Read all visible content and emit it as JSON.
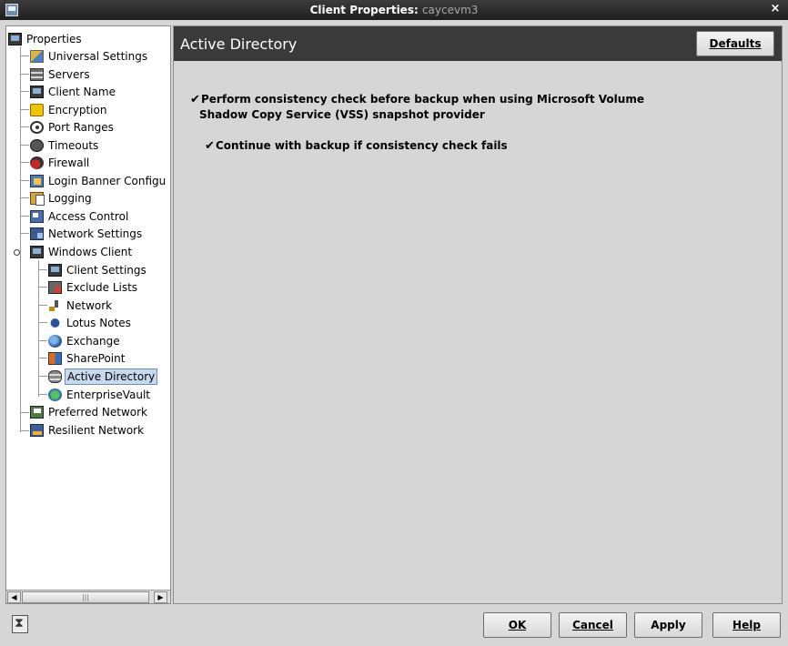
{
  "window": {
    "title_prefix": "Client Properties: ",
    "title_host": "caycevm3",
    "close_glyph": "×"
  },
  "tree": {
    "items": [
      {
        "label": "Properties",
        "icon": "computer-icon"
      },
      {
        "label": "Universal Settings",
        "icon": "universal-settings-icon"
      },
      {
        "label": "Servers",
        "icon": "servers-icon"
      },
      {
        "label": "Client Name",
        "icon": "computer-icon"
      },
      {
        "label": "Encryption",
        "icon": "lock-icon"
      },
      {
        "label": "Port Ranges",
        "icon": "port-icon"
      },
      {
        "label": "Timeouts",
        "icon": "timer-icon"
      },
      {
        "label": "Firewall",
        "icon": "firewall-icon"
      },
      {
        "label": "Login Banner Configu",
        "icon": "banner-icon"
      },
      {
        "label": "Logging",
        "icon": "logging-icon"
      },
      {
        "label": "Access Control",
        "icon": "access-control-icon"
      },
      {
        "label": "Network Settings",
        "icon": "network-settings-icon"
      },
      {
        "label": "Windows Client",
        "icon": "computer-icon"
      },
      {
        "label": "Client Settings",
        "icon": "computer-icon"
      },
      {
        "label": "Exclude Lists",
        "icon": "exclude-lists-icon"
      },
      {
        "label": "Network",
        "icon": "network-plug-icon"
      },
      {
        "label": "Lotus Notes",
        "icon": "lotus-notes-icon"
      },
      {
        "label": "Exchange",
        "icon": "exchange-icon"
      },
      {
        "label": "SharePoint",
        "icon": "sharepoint-icon"
      },
      {
        "label": "Active Directory",
        "icon": "active-directory-icon"
      },
      {
        "label": "EnterpriseVault",
        "icon": "enterprise-vault-icon"
      },
      {
        "label": "Preferred Network",
        "icon": "preferred-network-icon"
      },
      {
        "label": "Resilient Network",
        "icon": "resilient-network-icon"
      }
    ],
    "selected": "Active Directory"
  },
  "panel": {
    "title": "Active Directory",
    "defaults_button": "Defaults",
    "options": [
      {
        "line1": "Perform consistency check before backup when using Microsoft Volume",
        "line2": "Shadow Copy Service (VSS) snapshot provider",
        "checked": true
      },
      {
        "line1": "Continue with backup if consistency check fails",
        "checked": true
      }
    ],
    "check_glyph": "✔"
  },
  "buttons": {
    "ok": "OK",
    "cancel": "Cancel",
    "apply": "Apply",
    "help": "Help"
  },
  "scrollbar": {
    "left_arrow": "◀",
    "right_arrow": "▶",
    "thumb_grip": "|||"
  }
}
